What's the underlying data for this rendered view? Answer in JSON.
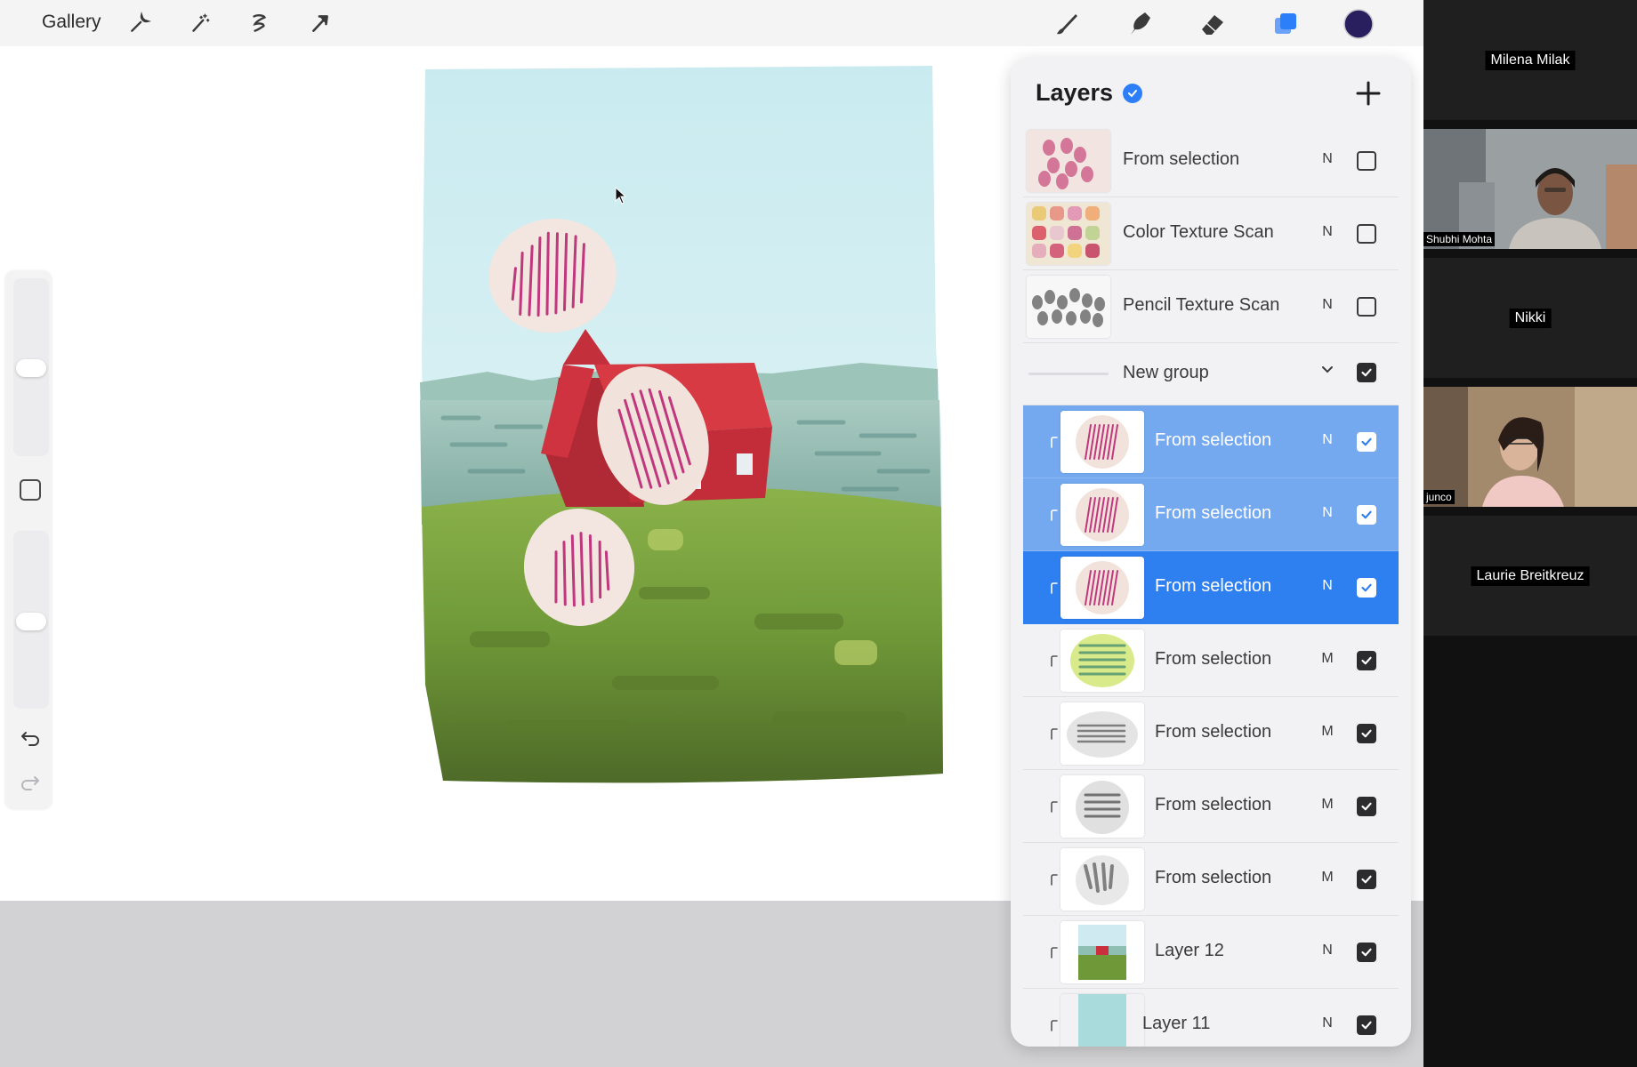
{
  "topbar": {
    "gallery_label": "Gallery",
    "left_icons": [
      "wrench-icon",
      "magic-wand-icon",
      "selection-icon",
      "transform-arrow-icon"
    ],
    "right_icons": [
      "brush-icon",
      "smudge-icon",
      "eraser-icon",
      "layers-icon",
      "color-swatch"
    ],
    "current_color": "#2a1f5e",
    "active_tool_color": "#2d7ff9"
  },
  "layers_panel": {
    "title": "Layers",
    "layers": [
      {
        "name": "From selection",
        "blend": "N",
        "visible": false,
        "indented": false,
        "selected": "none",
        "thumb": "pink-marks"
      },
      {
        "name": "Color Texture Scan",
        "blend": "N",
        "visible": false,
        "indented": false,
        "selected": "none",
        "thumb": "color-scan"
      },
      {
        "name": "Pencil Texture Scan",
        "blend": "N",
        "visible": false,
        "indented": false,
        "selected": "none",
        "thumb": "pencil-scan"
      },
      {
        "name": "New group",
        "blend": "",
        "visible": true,
        "indented": false,
        "selected": "none",
        "thumb": "group"
      },
      {
        "name": "From selection",
        "blend": "N",
        "visible": true,
        "indented": true,
        "selected": "light",
        "thumb": "pink-blob"
      },
      {
        "name": "From selection",
        "blend": "N",
        "visible": true,
        "indented": true,
        "selected": "light",
        "thumb": "pink-blob"
      },
      {
        "name": "From selection",
        "blend": "N",
        "visible": true,
        "indented": true,
        "selected": "strong",
        "thumb": "pink-blob"
      },
      {
        "name": "From selection",
        "blend": "M",
        "visible": true,
        "indented": true,
        "selected": "none",
        "thumb": "green-blob"
      },
      {
        "name": "From selection",
        "blend": "M",
        "visible": true,
        "indented": true,
        "selected": "none",
        "thumb": "gray-blob"
      },
      {
        "name": "From selection",
        "blend": "M",
        "visible": true,
        "indented": true,
        "selected": "none",
        "thumb": "gray-blob2"
      },
      {
        "name": "From selection",
        "blend": "M",
        "visible": true,
        "indented": true,
        "selected": "none",
        "thumb": "gray-blob3"
      },
      {
        "name": "Layer 12",
        "blend": "N",
        "visible": true,
        "indented": true,
        "selected": "none",
        "thumb": "landscape"
      },
      {
        "name": "Layer 11",
        "blend": "N",
        "visible": true,
        "indented": true,
        "selected": "none",
        "thumb": "sky"
      }
    ]
  },
  "participants": [
    {
      "name": "Milena Milak",
      "has_video": false
    },
    {
      "name": "Shubhi Mohta",
      "has_video": true
    },
    {
      "name": "Nikki",
      "has_video": false
    },
    {
      "name": "junco",
      "has_video": true
    },
    {
      "name": "Laurie Breitkreuz",
      "has_video": false
    }
  ]
}
